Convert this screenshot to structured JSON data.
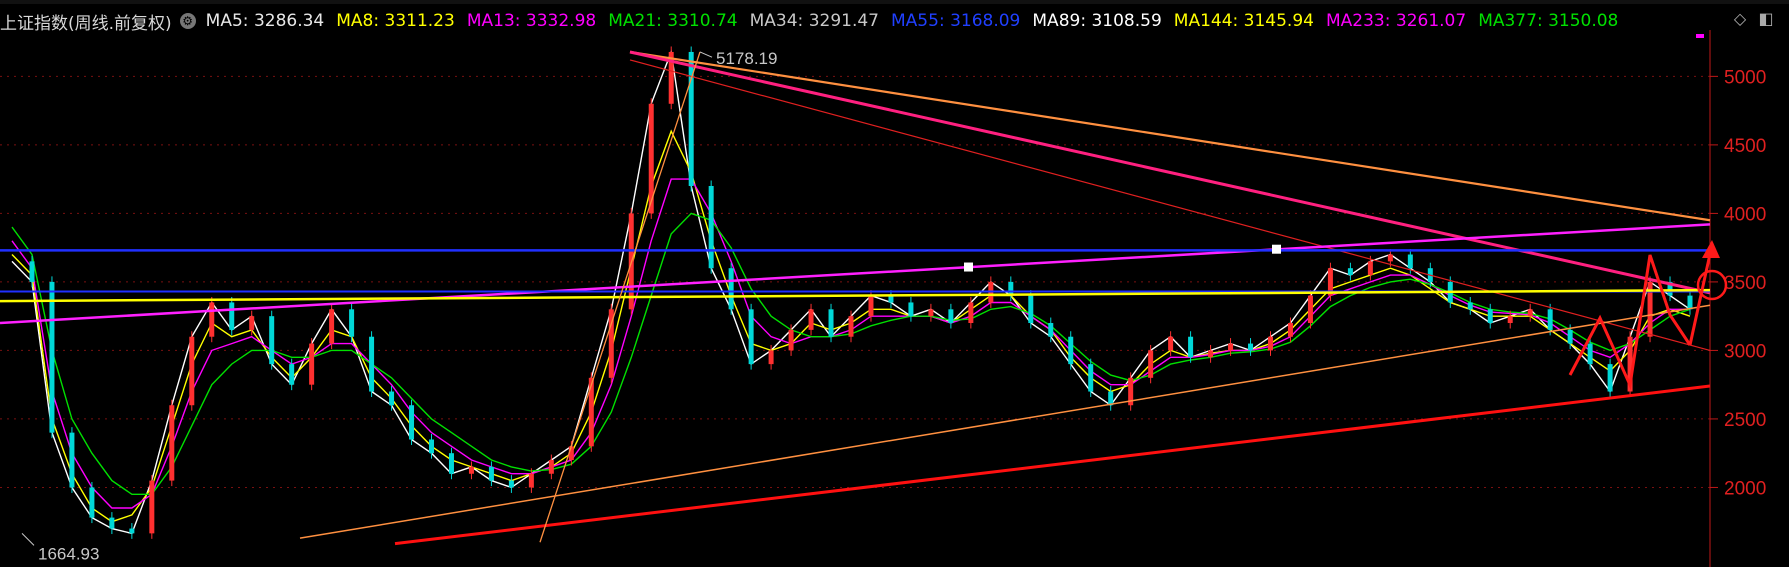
{
  "header": {
    "title": "上证指数(周线.前复权)",
    "ma_list": [
      {
        "label": "MA5",
        "value": "3286.34",
        "color": "#e8e8e8"
      },
      {
        "label": "MA8",
        "value": "3311.23",
        "color": "#ffff00"
      },
      {
        "label": "MA13",
        "value": "3332.98",
        "color": "#ff00ff"
      },
      {
        "label": "MA21",
        "value": "3310.74",
        "color": "#00e000"
      },
      {
        "label": "MA34",
        "value": "3291.47",
        "color": "#c8c8c8"
      },
      {
        "label": "MA55",
        "value": "3168.09",
        "color": "#2040ff"
      },
      {
        "label": "MA89",
        "value": "3108.59",
        "color": "#ffffff"
      },
      {
        "label": "MA144",
        "value": "3145.94",
        "color": "#ffff00"
      },
      {
        "label": "MA233",
        "value": "3261.07",
        "color": "#ff00ff"
      },
      {
        "label": "MA377",
        "value": "3150.08",
        "color": "#00e000"
      }
    ]
  },
  "chart_data": {
    "type": "line",
    "y_ticks": [
      2000,
      2500,
      3000,
      3500,
      4000,
      4500,
      5000
    ],
    "ylim": [
      1580,
      5280
    ],
    "annotations": [
      {
        "text": "5178.19",
        "kind": "high"
      },
      {
        "text": "1664.93",
        "kind": "low"
      }
    ],
    "series": [
      {
        "values": [
          3650,
          3500,
          2400,
          2000,
          1780,
          1700,
          1664.93,
          2050,
          2600,
          3100,
          3350,
          3150,
          3250,
          2900,
          2750,
          3050,
          3300,
          3100,
          2700,
          2600,
          2350,
          2250,
          2100,
          2150,
          2050,
          2000,
          2100,
          2200,
          2300,
          2800,
          3300,
          4000,
          4800,
          5178.19,
          4200,
          3600,
          3300,
          2900,
          3000,
          3150,
          3300,
          3100,
          3250,
          3400,
          3350,
          3250,
          3300,
          3200,
          3350,
          3500,
          3400,
          3200,
          3100,
          2900,
          2700,
          2600,
          2800,
          3000,
          3100,
          2950,
          3000,
          3050,
          3000,
          3100,
          3200,
          3400,
          3600,
          3550,
          3650,
          3700,
          3600,
          3500,
          3350,
          3300,
          3200,
          3250,
          3300,
          3150,
          3050,
          2900,
          2700,
          3100,
          3500,
          3400,
          3300
        ]
      },
      {
        "values": [
          3700,
          3550,
          2500,
          2100,
          1850,
          1750,
          1800,
          2000,
          2450,
          2900,
          3200,
          3100,
          3150,
          2950,
          2800,
          2950,
          3150,
          3100,
          2800,
          2650,
          2450,
          2300,
          2200,
          2150,
          2100,
          2050,
          2100,
          2150,
          2250,
          2550,
          3000,
          3600,
          4200,
          4600,
          4300,
          3800,
          3400,
          3050,
          3000,
          3050,
          3200,
          3150,
          3200,
          3300,
          3300,
          3250,
          3250,
          3200,
          3300,
          3400,
          3400,
          3250,
          3150,
          2950,
          2800,
          2700,
          2750,
          2900,
          3000,
          2950,
          2980,
          3000,
          3000,
          3050,
          3150,
          3300,
          3450,
          3500,
          3550,
          3600,
          3550,
          3450,
          3350,
          3300,
          3250,
          3250,
          3250,
          3150,
          3050,
          2950,
          2850,
          3000,
          3250,
          3300,
          3250
        ]
      },
      {
        "values": [
          3800,
          3600,
          2700,
          2250,
          2000,
          1850,
          1850,
          1950,
          2300,
          2700,
          3000,
          3050,
          3100,
          3000,
          2900,
          2950,
          3050,
          3050,
          2900,
          2750,
          2550,
          2400,
          2300,
          2200,
          2150,
          2100,
          2100,
          2150,
          2200,
          2400,
          2750,
          3250,
          3800,
          4250,
          4250,
          4000,
          3650,
          3250,
          3100,
          3050,
          3100,
          3100,
          3150,
          3250,
          3250,
          3250,
          3250,
          3200,
          3250,
          3350,
          3350,
          3250,
          3150,
          3000,
          2850,
          2750,
          2750,
          2850,
          2950,
          2950,
          2970,
          3000,
          3000,
          3030,
          3100,
          3250,
          3400,
          3450,
          3500,
          3550,
          3550,
          3480,
          3400,
          3330,
          3280,
          3270,
          3260,
          3200,
          3100,
          3000,
          2950,
          3050,
          3200,
          3300,
          3300
        ]
      },
      {
        "values": [
          3900,
          3700,
          3000,
          2500,
          2250,
          2050,
          1950,
          1950,
          2150,
          2450,
          2750,
          2900,
          3000,
          3000,
          2950,
          2950,
          3000,
          3000,
          2900,
          2800,
          2650,
          2500,
          2400,
          2300,
          2200,
          2150,
          2120,
          2130,
          2170,
          2300,
          2550,
          2950,
          3400,
          3850,
          4000,
          3950,
          3750,
          3450,
          3250,
          3150,
          3100,
          3100,
          3120,
          3180,
          3220,
          3250,
          3250,
          3220,
          3230,
          3300,
          3320,
          3270,
          3180,
          3050,
          2920,
          2820,
          2780,
          2820,
          2900,
          2930,
          2950,
          2980,
          2990,
          3010,
          3060,
          3180,
          3320,
          3400,
          3460,
          3500,
          3520,
          3480,
          3420,
          3350,
          3300,
          3280,
          3270,
          3230,
          3150,
          3060,
          3000,
          3050,
          3150,
          3250,
          3300
        ]
      }
    ]
  }
}
